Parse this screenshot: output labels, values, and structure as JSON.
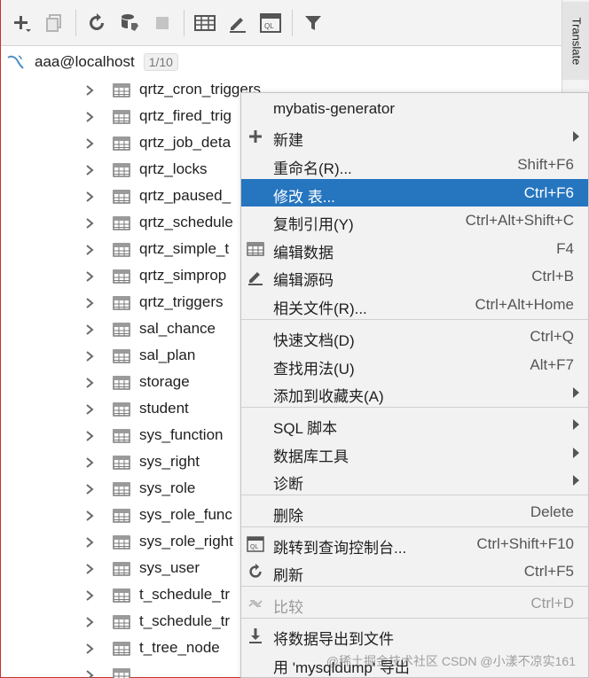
{
  "side_panel": {
    "tab_label": "Translate"
  },
  "toolbar": {
    "buttons": [
      "add-icon",
      "copy-icon",
      "refresh-icon",
      "schema-settings-icon",
      "stop-icon",
      "table-icon",
      "edit-icon",
      "console-icon",
      "filter-icon"
    ]
  },
  "tree": {
    "root": {
      "label": "aaa@localhost",
      "count": "1/10"
    },
    "tables": [
      "qrtz_cron_triggers",
      "qrtz_fired_trig",
      "qrtz_job_deta",
      "qrtz_locks",
      "qrtz_paused_",
      "qrtz_schedule",
      "qrtz_simple_t",
      "qrtz_simprop",
      "qrtz_triggers",
      "sal_chance",
      "sal_plan",
      "storage",
      "student",
      "sys_function",
      "sys_right",
      "sys_role",
      "sys_role_func",
      "sys_role_right",
      "sys_user",
      "t_schedule_tr",
      "t_schedule_tr",
      "t_tree_node",
      ""
    ]
  },
  "context_menu": {
    "items": [
      {
        "label": "mybatis-generator",
        "shortcut": "",
        "submenu": false,
        "icon": ""
      },
      {
        "label": "新建",
        "shortcut": "",
        "submenu": true,
        "icon": "plus-icon"
      },
      {
        "label": "重命名(R)...",
        "shortcut": "Shift+F6",
        "submenu": false,
        "icon": ""
      },
      {
        "label": "修改 表...",
        "shortcut": "Ctrl+F6",
        "submenu": false,
        "icon": "",
        "selected": true
      },
      {
        "label": "复制引用(Y)",
        "shortcut": "Ctrl+Alt+Shift+C",
        "submenu": false,
        "icon": ""
      },
      {
        "label": "编辑数据",
        "shortcut": "F4",
        "submenu": false,
        "icon": "table-icon"
      },
      {
        "label": "编辑源码",
        "shortcut": "Ctrl+B",
        "submenu": false,
        "icon": "pencil-icon"
      },
      {
        "label": "相关文件(R)...",
        "shortcut": "Ctrl+Alt+Home",
        "submenu": false,
        "icon": ""
      },
      {
        "label": "快速文档(D)",
        "shortcut": "Ctrl+Q",
        "submenu": false,
        "icon": ""
      },
      {
        "label": "查找用法(U)",
        "shortcut": "Alt+F7",
        "submenu": false,
        "icon": ""
      },
      {
        "label": "添加到收藏夹(A)",
        "shortcut": "",
        "submenu": true,
        "icon": ""
      },
      {
        "label": "SQL 脚本",
        "shortcut": "",
        "submenu": true,
        "icon": ""
      },
      {
        "label": "数据库工具",
        "shortcut": "",
        "submenu": true,
        "icon": ""
      },
      {
        "label": "诊断",
        "shortcut": "",
        "submenu": true,
        "icon": ""
      },
      {
        "label": "删除",
        "shortcut": "Delete",
        "submenu": false,
        "icon": ""
      },
      {
        "label": "跳转到查询控制台...",
        "shortcut": "Ctrl+Shift+F10",
        "submenu": false,
        "icon": "console-icon"
      },
      {
        "label": "刷新",
        "shortcut": "Ctrl+F5",
        "submenu": false,
        "icon": "refresh-icon"
      },
      {
        "label": "比较",
        "shortcut": "Ctrl+D",
        "submenu": false,
        "icon": "compare-icon",
        "disabled": true
      },
      {
        "label": "将数据导出到文件",
        "shortcut": "",
        "submenu": false,
        "icon": "export-icon"
      },
      {
        "label": "用 'mysqldump' 导出",
        "shortcut": "",
        "submenu": false,
        "icon": ""
      }
    ]
  },
  "watermark": "CSDN @小漾不凉实161",
  "watermark2": "@稀土掘金技术社区"
}
